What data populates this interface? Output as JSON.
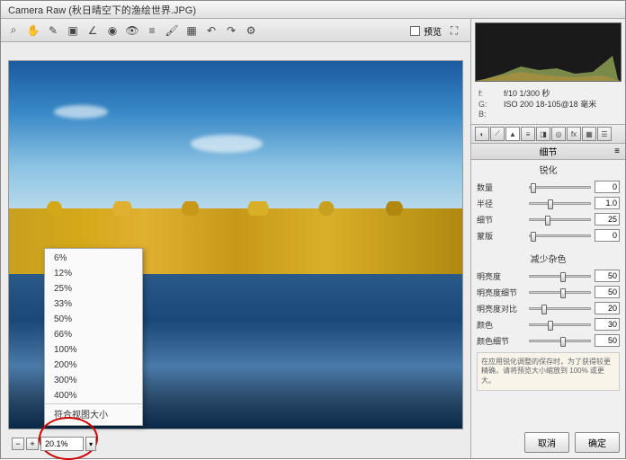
{
  "title": "Camera Raw (秋日晴空下的渔绘世界.JPG)",
  "toolbar": {
    "tools": [
      "magnify-icon",
      "hand-icon",
      "eyedropper-icon",
      "crop-icon",
      "straighten-icon",
      "spot-icon",
      "redeye-icon",
      "adjust-icon",
      "brush-icon",
      "gradient-icon",
      "rotate-left-icon",
      "rotate-right-icon",
      "prefs-icon"
    ],
    "preview_label": "预览"
  },
  "zoom": {
    "current": "20.1%",
    "options": [
      "6%",
      "12%",
      "25%",
      "33%",
      "50%",
      "66%",
      "100%",
      "200%",
      "300%",
      "400%",
      "符合视图大小"
    ]
  },
  "exif": {
    "line1_label": "f:",
    "line1_value": "f/10 1/300 秒",
    "line2_label": "G:",
    "line2_value": "ISO 200 18-105@18 毫米",
    "line3_label": "B:",
    "line3_value": ""
  },
  "panel_title": "细节",
  "sharpen": {
    "section": "锐化",
    "sliders": [
      {
        "label": "数量",
        "value": "0",
        "pos": 2
      },
      {
        "label": "半径",
        "value": "1.0",
        "pos": 30
      },
      {
        "label": "细节",
        "value": "25",
        "pos": 25
      },
      {
        "label": "蒙版",
        "value": "0",
        "pos": 2
      }
    ]
  },
  "noise": {
    "section": "减少杂色",
    "sliders": [
      {
        "label": "明亮度",
        "value": "50",
        "pos": 50
      },
      {
        "label": "明亮度细节",
        "value": "50",
        "pos": 50
      },
      {
        "label": "明亮度对比",
        "value": "20",
        "pos": 20
      },
      {
        "label": "颜色",
        "value": "30",
        "pos": 30
      },
      {
        "label": "颜色细节",
        "value": "50",
        "pos": 50
      }
    ]
  },
  "hint": "在应用锐化调整的保存时，为了获得较更精确，请将预览大小缩放到 100% 或更大。",
  "buttons": {
    "cancel": "取消",
    "ok": "确定"
  }
}
